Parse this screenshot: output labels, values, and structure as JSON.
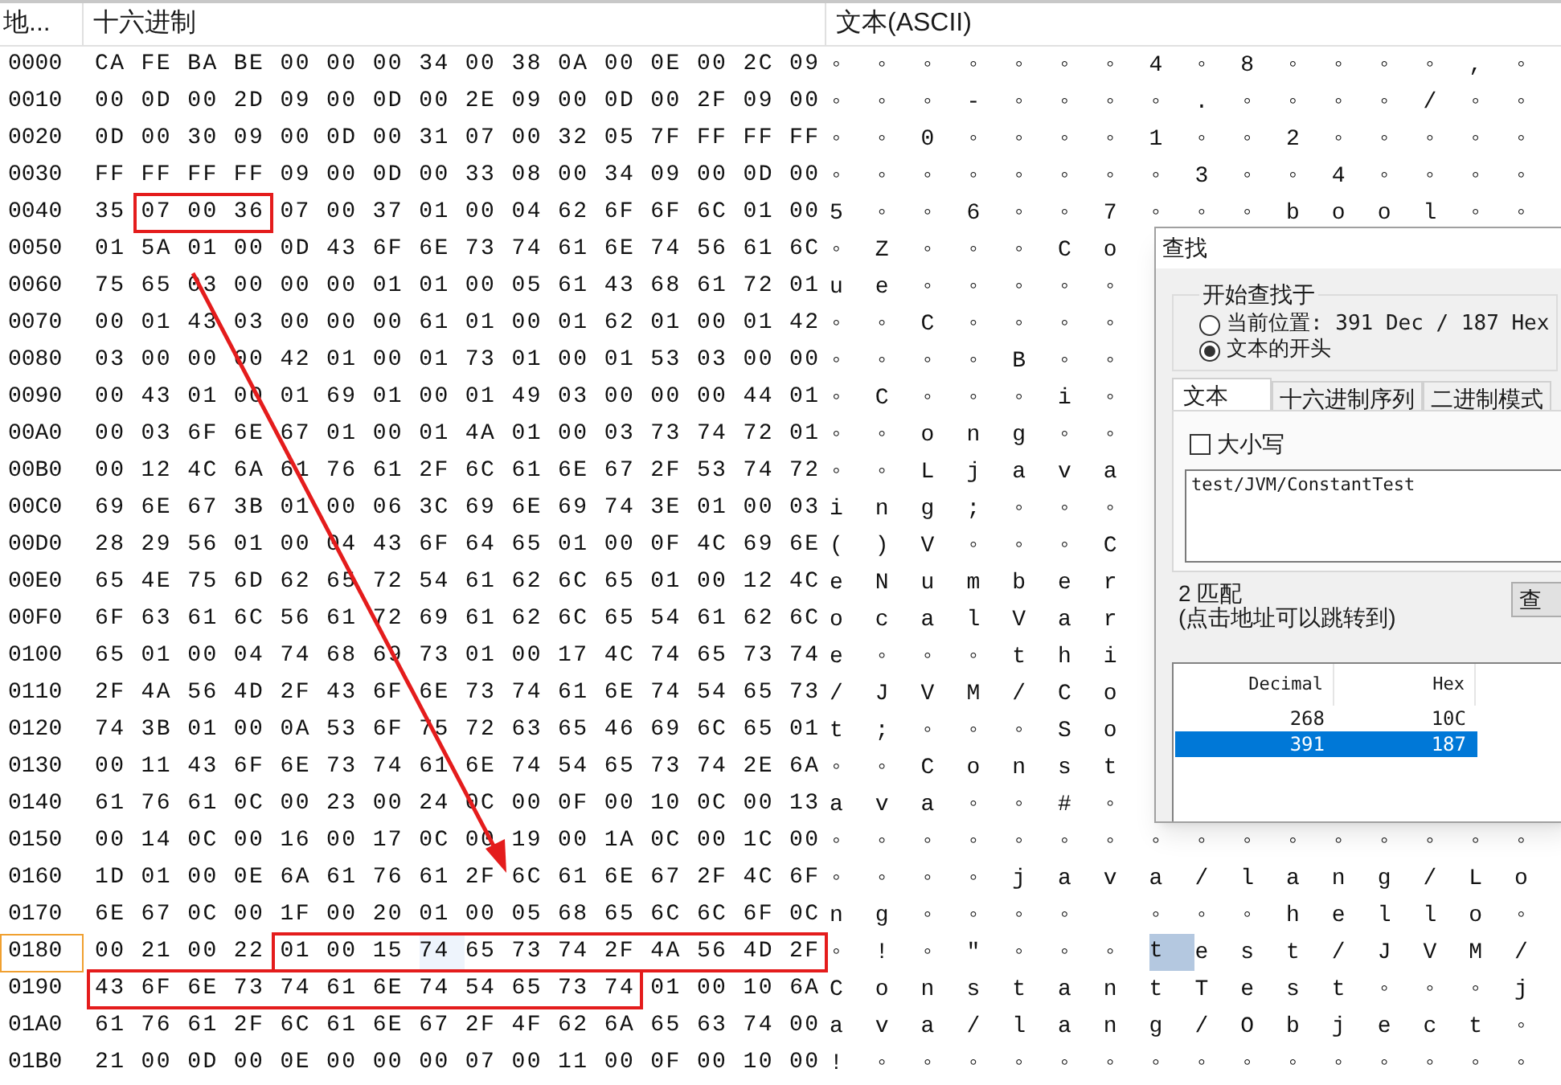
{
  "columns": [
    {
      "label": "地..."
    },
    {
      "label": "十六进制"
    },
    {
      "label": "文本(ASCII)"
    }
  ],
  "rows": [
    {
      "address": "0000",
      "current": false,
      "hex": [
        {
          "text": "CA FE BA BE 00 00 00 34 00 38 0A 00 0E 00 2C 09",
          "boxed": false,
          "selected": false
        }
      ],
      "ascii": [
        {
          "text": "◦◦◦◦◦◦◦4◦8◦◦◦◦,◦",
          "selected": false
        }
      ]
    },
    {
      "address": "0010",
      "current": false,
      "hex": [
        {
          "text": "00 0D 00 2D 09 00 0D 00 2E 09 00 0D 00 2F 09 00",
          "boxed": false,
          "selected": false
        }
      ],
      "ascii": [
        {
          "text": "◦◦◦-◦◦◦◦.◦◦◦◦/◦◦",
          "selected": false
        }
      ]
    },
    {
      "address": "0020",
      "current": false,
      "hex": [
        {
          "text": "0D 00 30 09 00 0D 00 31 07 00 32 05 7F FF FF FF",
          "boxed": false,
          "selected": false
        }
      ],
      "ascii": [
        {
          "text": "◦◦0◦◦◦◦1◦◦2◦◦◦◦◦",
          "selected": false
        }
      ]
    },
    {
      "address": "0030",
      "current": false,
      "hex": [
        {
          "text": "FF FF FF FF 09 00 0D 00 33 08 00 34 09 00 0D 00",
          "boxed": false,
          "selected": false
        }
      ],
      "ascii": [
        {
          "text": "◦◦◦◦◦◦◦◦3◦◦4◦◦◦◦",
          "selected": false
        }
      ]
    },
    {
      "address": "0040",
      "current": false,
      "hex": [
        {
          "text": "35",
          "boxed": false,
          "selected": false
        },
        {
          "text": "07 00 36",
          "boxed": true,
          "selected": false
        },
        {
          "text": "07 00 37 01 00 04 62 6F 6F 6C 01 00",
          "boxed": false,
          "selected": false
        }
      ],
      "ascii": [
        {
          "text": "5◦◦6◦◦7◦◦◦bool◦◦",
          "selected": false
        }
      ]
    },
    {
      "address": "0050",
      "current": false,
      "hex": [
        {
          "text": "01 5A 01 00 0D 43 6F 6E 73 74 61 6E 74 56 61 6C",
          "boxed": false,
          "selected": false
        }
      ],
      "ascii": [
        {
          "text": "◦Z◦◦◦Co",
          "selected": false
        }
      ]
    },
    {
      "address": "0060",
      "current": false,
      "hex": [
        {
          "text": "75 65 03 00 00 00 01 01 00 05 61 43 68 61 72 01",
          "boxed": false,
          "selected": false
        }
      ],
      "ascii": [
        {
          "text": "ue◦◦◦◦◦",
          "selected": false
        }
      ]
    },
    {
      "address": "0070",
      "current": false,
      "hex": [
        {
          "text": "00 01 43 03 00 00 00 61 01 00 01 62 01 00 01 42",
          "boxed": false,
          "selected": false
        }
      ],
      "ascii": [
        {
          "text": "◦◦C◦◦◦◦",
          "selected": false
        }
      ]
    },
    {
      "address": "0080",
      "current": false,
      "hex": [
        {
          "text": "03 00 00 00 42 01 00 01 73 01 00 01 53 03 00 00",
          "boxed": false,
          "selected": false
        }
      ],
      "ascii": [
        {
          "text": "◦◦◦◦B◦◦",
          "selected": false
        }
      ]
    },
    {
      "address": "0090",
      "current": false,
      "hex": [
        {
          "text": "00 43 01 00 01 69 01 00 01 49 03 00 00 00 44 01",
          "boxed": false,
          "selected": false
        }
      ],
      "ascii": [
        {
          "text": "◦C◦◦◦i◦",
          "selected": false
        }
      ]
    },
    {
      "address": "00A0",
      "current": false,
      "hex": [
        {
          "text": "00 03 6F 6E 67 01 00 01 4A 01 00 03 73 74 72 01",
          "boxed": false,
          "selected": false
        }
      ],
      "ascii": [
        {
          "text": "◦◦ong◦◦",
          "selected": false
        }
      ]
    },
    {
      "address": "00B0",
      "current": false,
      "hex": [
        {
          "text": "00 12 4C 6A 61 76 61 2F 6C 61 6E 67 2F 53 74 72",
          "boxed": false,
          "selected": false
        }
      ],
      "ascii": [
        {
          "text": "◦◦Ljava",
          "selected": false
        }
      ]
    },
    {
      "address": "00C0",
      "current": false,
      "hex": [
        {
          "text": "69 6E 67 3B 01 00 06 3C 69 6E 69 74 3E 01 00 03",
          "boxed": false,
          "selected": false
        }
      ],
      "ascii": [
        {
          "text": "ing;◦◦◦",
          "selected": false
        }
      ]
    },
    {
      "address": "00D0",
      "current": false,
      "hex": [
        {
          "text": "28 29 56 01 00 04 43 6F 64 65 01 00 0F 4C 69 6E",
          "boxed": false,
          "selected": false
        }
      ],
      "ascii": [
        {
          "text": "()V◦◦◦C",
          "selected": false
        }
      ]
    },
    {
      "address": "00E0",
      "current": false,
      "hex": [
        {
          "text": "65 4E 75 6D 62 65 72 54 61 62 6C 65 01 00 12 4C",
          "boxed": false,
          "selected": false
        }
      ],
      "ascii": [
        {
          "text": "eNumber",
          "selected": false
        }
      ]
    },
    {
      "address": "00F0",
      "current": false,
      "hex": [
        {
          "text": "6F 63 61 6C 56 61 72 69 61 62 6C 65 54 61 62 6C",
          "boxed": false,
          "selected": false
        }
      ],
      "ascii": [
        {
          "text": "ocalVar",
          "selected": false
        }
      ]
    },
    {
      "address": "0100",
      "current": false,
      "hex": [
        {
          "text": "65 01 00 04 74 68 69 73 01 00 17 4C 74 65 73 74",
          "boxed": false,
          "selected": false
        }
      ],
      "ascii": [
        {
          "text": "e◦◦◦thi",
          "selected": false
        }
      ]
    },
    {
      "address": "0110",
      "current": false,
      "hex": [
        {
          "text": "2F 4A 56 4D 2F 43 6F 6E 73 74 61 6E 74 54 65 73",
          "boxed": false,
          "selected": false
        }
      ],
      "ascii": [
        {
          "text": "/JVM/Co",
          "selected": false
        }
      ]
    },
    {
      "address": "0120",
      "current": false,
      "hex": [
        {
          "text": "74 3B 01 00 0A 53 6F 75 72 63 65 46 69 6C 65 01",
          "boxed": false,
          "selected": false
        }
      ],
      "ascii": [
        {
          "text": "t;◦◦◦So",
          "selected": false
        }
      ]
    },
    {
      "address": "0130",
      "current": false,
      "hex": [
        {
          "text": "00 11 43 6F 6E 73 74 61 6E 74 54 65 73 74 2E 6A",
          "boxed": false,
          "selected": false
        }
      ],
      "ascii": [
        {
          "text": "◦◦Const",
          "selected": false
        }
      ]
    },
    {
      "address": "0140",
      "current": false,
      "hex": [
        {
          "text": "61 76 61 0C 00 23 00 24 0C 00 0F 00 10 0C 00 13",
          "boxed": false,
          "selected": false
        }
      ],
      "ascii": [
        {
          "text": "ava◦◦#◦",
          "selected": false
        }
      ]
    },
    {
      "address": "0150",
      "current": false,
      "hex": [
        {
          "text": "00 14 0C 00 16 00 17 0C 00 19 00 1A 0C 00 1C 00",
          "boxed": false,
          "selected": false
        }
      ],
      "ascii": [
        {
          "text": "◦◦◦◦◦◦◦◦◦◦◦◦◦◦◦◦",
          "selected": false
        }
      ]
    },
    {
      "address": "0160",
      "current": false,
      "hex": [
        {
          "text": "1D 01 00 0E 6A 61 76 61 2F 6C 61 6E 67 2F 4C 6F",
          "boxed": false,
          "selected": false
        }
      ],
      "ascii": [
        {
          "text": "◦◦◦◦java/lang/Lo",
          "selected": false
        }
      ]
    },
    {
      "address": "0170",
      "current": false,
      "hex": [
        {
          "text": "6E 67 0C 00 1F 00 20 01 00 05 68 65 6C 6C 6F 0C",
          "boxed": false,
          "selected": false
        }
      ],
      "ascii": [
        {
          "text": "ng◦◦◦◦ ◦◦◦hello◦",
          "selected": false
        }
      ]
    },
    {
      "address": "0180",
      "current": true,
      "hex": [
        {
          "text": "00 21 00 22",
          "boxed": false,
          "selected": false
        },
        {
          "text": "01 00 15",
          "boxed": true,
          "selected": false
        },
        {
          "text": "74",
          "boxed": true,
          "selected": true
        },
        {
          "text": "65 73 74 2F 4A 56 4D 2F",
          "boxed": true,
          "selected": false
        }
      ],
      "ascii": [
        {
          "text": "◦!◦\"◦◦◦",
          "selected": false
        },
        {
          "text": "t",
          "selected": true
        },
        {
          "text": "est/JVM/",
          "selected": false
        }
      ]
    },
    {
      "address": "0190",
      "current": false,
      "hex": [
        {
          "text": "43 6F 6E 73 74 61 6E 74 54 65 73 74",
          "boxed": true,
          "selected": false
        },
        {
          "text": "01 00 10 6A",
          "boxed": false,
          "selected": false
        }
      ],
      "ascii": [
        {
          "text": "ConstantTest◦◦◦j",
          "selected": false
        }
      ]
    },
    {
      "address": "01A0",
      "current": false,
      "hex": [
        {
          "text": "61 76 61 2F 6C 61 6E 67 2F 4F 62 6A 65 63 74 00",
          "boxed": false,
          "selected": false
        }
      ],
      "ascii": [
        {
          "text": "ava/lang/Object◦",
          "selected": false
        }
      ]
    },
    {
      "address": "01B0",
      "current": false,
      "hex": [
        {
          "text": "21 00 0D 00 0E 00 00 00 07 00 11 00 0F 00 10 00",
          "boxed": false,
          "selected": false
        }
      ],
      "ascii": [
        {
          "text": "!◦◦◦◦◦◦◦◦◦◦◦◦◦◦◦",
          "selected": false
        }
      ]
    }
  ],
  "find_dialog": {
    "title": "查找",
    "start_group": {
      "label": "开始查找于",
      "options": [
        {
          "label": "当前位置: 391 Dec / 187 Hex",
          "selected": false
        },
        {
          "label": "文本的开头",
          "selected": true
        }
      ]
    },
    "tabs": [
      {
        "label": "文本",
        "selected": true
      },
      {
        "label": "十六进制序列",
        "selected": false
      },
      {
        "label": "二进制模式",
        "selected": false
      }
    ],
    "case_checkbox": {
      "label": "大小写",
      "checked": false
    },
    "query": "test/JVM/ConstantTest",
    "match_count": "2 匹配",
    "hint": "(点击地址可以跳转到)",
    "find_button": "查",
    "results": {
      "columns": [
        "Decimal",
        "Hex"
      ],
      "rows": [
        {
          "decimal": "268",
          "hex": "10C",
          "selected": false
        },
        {
          "decimal": "391",
          "hex": "187",
          "selected": true
        }
      ]
    }
  }
}
